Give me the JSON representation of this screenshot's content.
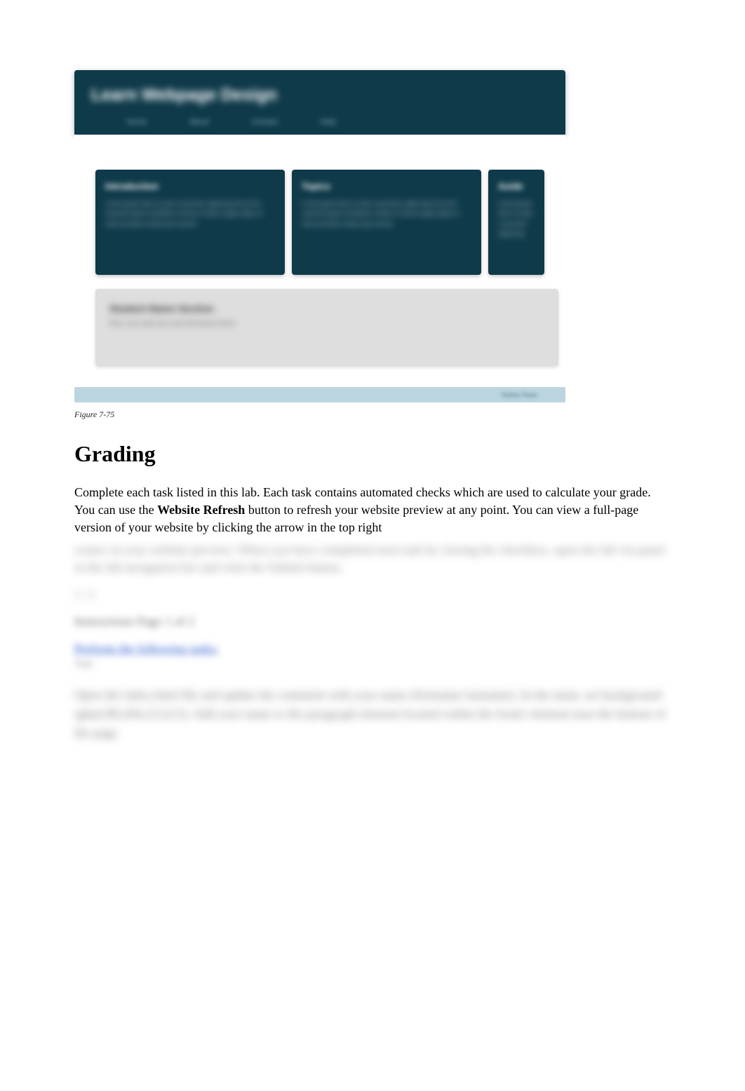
{
  "preview": {
    "site_title": "Learn Webpage Design",
    "nav": [
      "Home",
      "About",
      "Contact",
      "Help"
    ],
    "cards": [
      {
        "title": "Introduction",
        "body": "Lorem ipsum dolor sit amet consectetur adipiscing elit sed do eiusmod tempor incididunt ut labore et dolore magna aliqua ut enim ad minim veniam quis nostrud"
      },
      {
        "title": "Topics",
        "body": "Lorem ipsum dolor sit amet consectetur adipiscing elit sed do eiusmod tempor incididunt ut labore et dolore magna aliqua ut enim ad minim veniam quis nostrud"
      },
      {
        "title": "Aside",
        "body": "Lorem ipsum dolor sit amet consectetur adipiscing"
      }
    ],
    "grey_panel": {
      "title": "Student Name Section",
      "body": "Place your name here and information below"
    },
    "footer_text": "Student Name"
  },
  "figure_caption": "Figure 7-75",
  "grading": {
    "heading": "Grading",
    "para1_a": "Complete each task listed in this lab. Each task contains automated checks which are used to calculate your grade. You can use the ",
    "para1_bold": "Website Refresh",
    "para1_b": " button to refresh your website preview at any point. You can view a full-page version of your website by clicking the arrow in the top right",
    "para1_blurred": "corner of your website preview. When you have completed each task by closing the checkbox, open the lab via panel in the lab navigation bar and click the Submit button.",
    "counter": "1 / 2",
    "instructions_label": "Instructions Page 1 of 2",
    "task_link": "Perform the following tasks:",
    "task_sub": "Task",
    "task_body": "Open the index.html file and update the comment with your name (firstname lastname). In the main, set background rgba(189,204,212,0.5). Add your name to the paragraph element located within the footer element near the bottom of the page."
  }
}
